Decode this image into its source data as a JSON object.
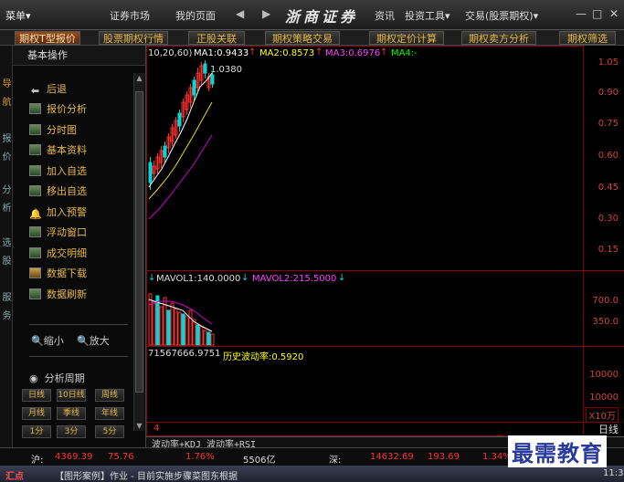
{
  "topbar": {
    "menu": "菜单▾",
    "nav": [
      "证券市场",
      "我的页面"
    ],
    "arrows": "◀ ▶",
    "brand": "浙商证券",
    "right_menu": [
      "资讯",
      "投资工具▾",
      "交易(股票期权)▾"
    ],
    "window_controls": [
      "—",
      "□",
      "✕"
    ]
  },
  "tabs": [
    "期权T型报价",
    "股票期权行情",
    "正股关联",
    "期权策略交易",
    "期权定价计算",
    "期权卖方分析",
    "期权筛选"
  ],
  "left_strip": [
    "导",
    "航",
    "报",
    "价",
    "分",
    "析",
    "选",
    "股",
    "服",
    "务"
  ],
  "sidebar": {
    "header": "基本操作",
    "items": [
      {
        "label": "后退",
        "icon": "back-arrow-icon"
      },
      {
        "label": "报价分析",
        "icon": "quote-analysis-icon"
      },
      {
        "label": "分时图",
        "icon": "intraday-chart-icon"
      },
      {
        "label": "基本资料",
        "icon": "profile-icon"
      },
      {
        "label": "加入自选",
        "icon": "add-favorite-icon"
      },
      {
        "label": "移出自选",
        "icon": "remove-favorite-icon"
      },
      {
        "label": "加入预警",
        "icon": "alert-bell-icon"
      },
      {
        "label": "浮动窗口",
        "icon": "float-window-icon"
      },
      {
        "label": "成交明细",
        "icon": "trade-detail-icon"
      },
      {
        "label": "数据下载",
        "icon": "download-icon"
      },
      {
        "label": "数据刷新",
        "icon": "refresh-icon"
      }
    ],
    "zoom_out": "缩小",
    "zoom_in": "放大",
    "period_title": "分析周期",
    "period_buttons": [
      "日线",
      "10日线",
      "周线",
      "月线",
      "季线",
      "年线",
      "1分",
      "3分",
      "5分"
    ]
  },
  "chart": {
    "main_legend": {
      "prefix": "10,20,60)",
      "ma1": "MA1:0.9433",
      "ma2": "MA2:0.8573",
      "ma3": "MA3:0.6976",
      "ma4": "MA4:-"
    },
    "high_label": "1.0380",
    "vol_legend": {
      "mavol1": "MAVOL1:140.0000",
      "mavol2": "MAVOL2:215.5000"
    },
    "vol_indicator": "71567666.9751",
    "volatility_label": "历史波动率:0.5920",
    "price_axis": [
      "1.05",
      "0.90",
      "0.75",
      "0.60",
      "0.45",
      "0.30",
      "0.15"
    ],
    "vol_axis": [
      "700.0",
      "350.0"
    ],
    "ind_axis": [
      "10000",
      "10000"
    ],
    "unit_label": "X10万",
    "period_label": "日线",
    "ind_marker": "4",
    "colors": {
      "ma1": "#ffffff",
      "ma2": "#ffff00",
      "ma3": "#ff00ff",
      "ma4": "#00ff00",
      "up": "#ff3030",
      "down": "#00d8d8",
      "grid": "#8b0000"
    }
  },
  "bottom_tabs": [
    "波动率+KDJ",
    "波动率+RSI"
  ],
  "status": {
    "sh_label": "沪:",
    "sh_index": "4369.39",
    "sh_change": "75.76",
    "sh_pct": "1.76%",
    "sh_volume": "5506亿",
    "sz_label": "深:",
    "sz_index": "14632.69",
    "sz_change": "193.69",
    "sz_pct": "1.34%"
  },
  "taskbar": {
    "start": "汇点",
    "item": "【图形案例】作业 - 目前实施步骤菜图东根据",
    "clock": "11:3"
  },
  "watermark": "最需教育"
}
